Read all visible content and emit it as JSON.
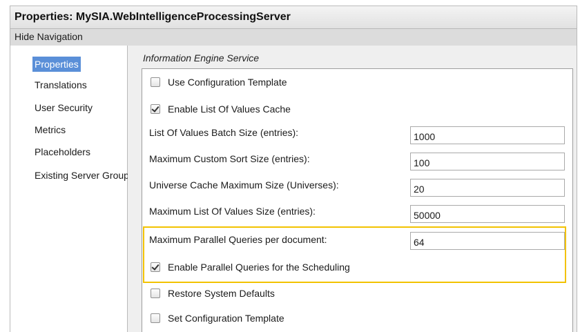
{
  "window": {
    "title": "Properties: MySIA.WebIntelligenceProcessingServer"
  },
  "hide_navigation": "Hide Navigation",
  "sidebar": {
    "items": [
      {
        "label": "Properties",
        "selected": true
      },
      {
        "label": "Translations"
      },
      {
        "label": "User Security"
      },
      {
        "label": "Metrics"
      },
      {
        "label": "Placeholders"
      },
      {
        "label": "Existing Server Group"
      }
    ]
  },
  "section": {
    "title": "Information Engine Service",
    "use_config_template": {
      "label": "Use Configuration Template",
      "checked": false
    },
    "enable_lov_cache": {
      "label": "Enable List Of Values Cache",
      "checked": true
    },
    "fields": [
      {
        "label": "List Of Values Batch Size (entries):",
        "value": "1000"
      },
      {
        "label": "Maximum Custom Sort Size (entries):",
        "value": "100"
      },
      {
        "label": "Universe Cache Maximum Size (Universes):",
        "value": "20"
      },
      {
        "label": "Maximum List Of Values Size (entries):",
        "value": "50000"
      },
      {
        "label": "Maximum Parallel Queries per document:",
        "value": "64"
      }
    ],
    "enable_parallel_scheduling": {
      "label": "Enable Parallel Queries for the Scheduling",
      "checked": true
    },
    "restore_defaults": {
      "label": "Restore System Defaults",
      "checked": false
    },
    "set_config_template": {
      "label": "Set Configuration Template",
      "checked": false
    }
  },
  "colors": {
    "highlight": "#f2c200",
    "selected_nav": "#5a8fd8"
  }
}
